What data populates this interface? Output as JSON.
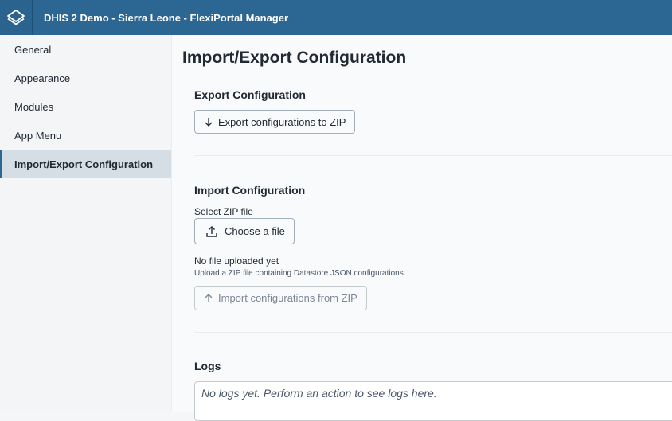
{
  "header": {
    "title": "DHIS 2 Demo - Sierra Leone - FlexiPortal Manager",
    "logo_icon": "layers-icon"
  },
  "sidebar": {
    "items": [
      {
        "label": "General"
      },
      {
        "label": "Appearance"
      },
      {
        "label": "Modules"
      },
      {
        "label": "App Menu"
      },
      {
        "label": "Import/Export Configuration",
        "active": true
      }
    ]
  },
  "main": {
    "page_title": "Import/Export Configuration",
    "export": {
      "title": "Export Configuration",
      "button_label": "Export configurations to ZIP",
      "button_icon": "arrow-down-icon"
    },
    "import": {
      "title": "Import Configuration",
      "file_label": "Select ZIP file",
      "choose_label": "Choose a file",
      "choose_icon": "upload-icon",
      "status": "No file uploaded yet",
      "help": "Upload a ZIP file containing Datastore JSON configurations.",
      "import_button_label": "Import configurations from ZIP",
      "import_button_icon": "arrow-up-icon"
    },
    "logs": {
      "title": "Logs",
      "placeholder": "No logs yet. Perform an action to see logs here."
    }
  },
  "colors": {
    "header": "#2c6693",
    "active_item": "#d5dde5",
    "text": "#212934"
  }
}
